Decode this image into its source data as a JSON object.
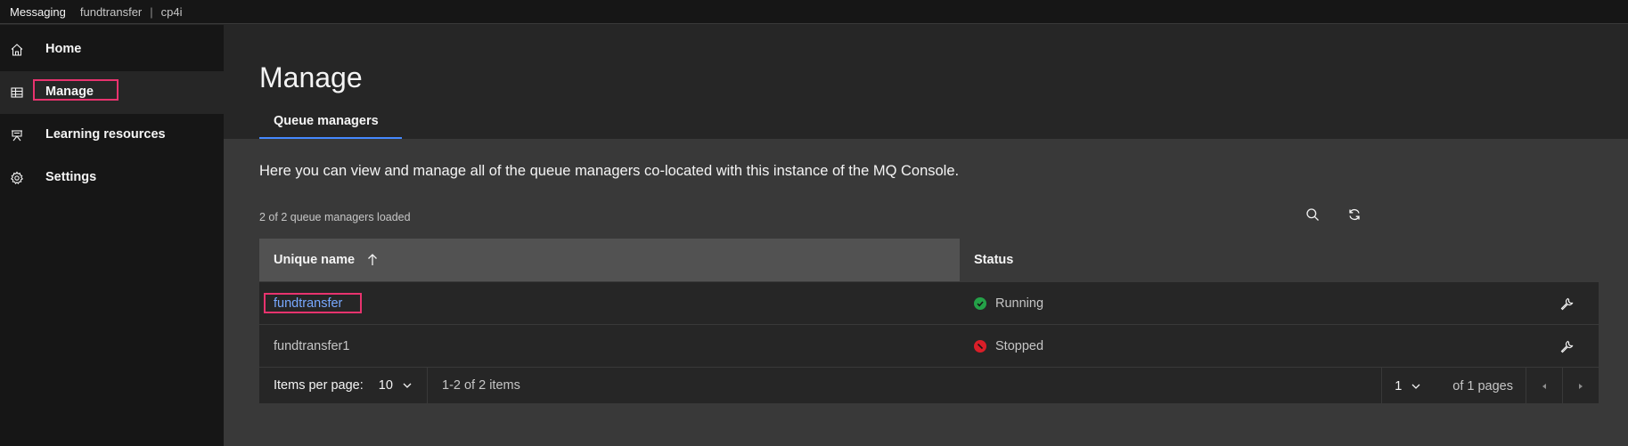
{
  "topbar": {
    "brand": "Messaging",
    "breadcrumb": [
      "fundtransfer",
      "cp4i"
    ],
    "separator": "|"
  },
  "sidebar": {
    "items": [
      {
        "label": "Home",
        "icon": "home-icon",
        "active": false
      },
      {
        "label": "Manage",
        "icon": "table-icon",
        "active": true
      },
      {
        "label": "Learning resources",
        "icon": "presentation-icon",
        "active": false
      },
      {
        "label": "Settings",
        "icon": "gear-icon",
        "active": false
      }
    ]
  },
  "main": {
    "title": "Manage",
    "tabs": [
      {
        "label": "Queue managers",
        "selected": true
      }
    ],
    "description": "Here you can view and manage all of the queue managers co-located with this instance of the MQ Console.",
    "loaded_count": "2 of 2 queue managers loaded",
    "toolbar": {
      "search_icon": "search-icon",
      "refresh_icon": "refresh-icon"
    },
    "table": {
      "columns": [
        "Unique name",
        "Status"
      ],
      "sort": {
        "column": "Unique name",
        "direction": "ascending"
      },
      "rows": [
        {
          "name": "fundtransfer",
          "status": "Running",
          "status_color": "#24a148",
          "link": true
        },
        {
          "name": "fundtransfer1",
          "status": "Stopped",
          "status_color": "#da1e28",
          "link": false
        }
      ]
    },
    "pagination": {
      "items_per_page_label": "Items per page:",
      "items_per_page": "10",
      "range": "1-2 of 2 items",
      "page": "1",
      "of_pages": "of 1 pages"
    }
  },
  "colors": {
    "accent": "#4589ff",
    "highlight": "#e8336e",
    "link": "#78a9ff"
  }
}
